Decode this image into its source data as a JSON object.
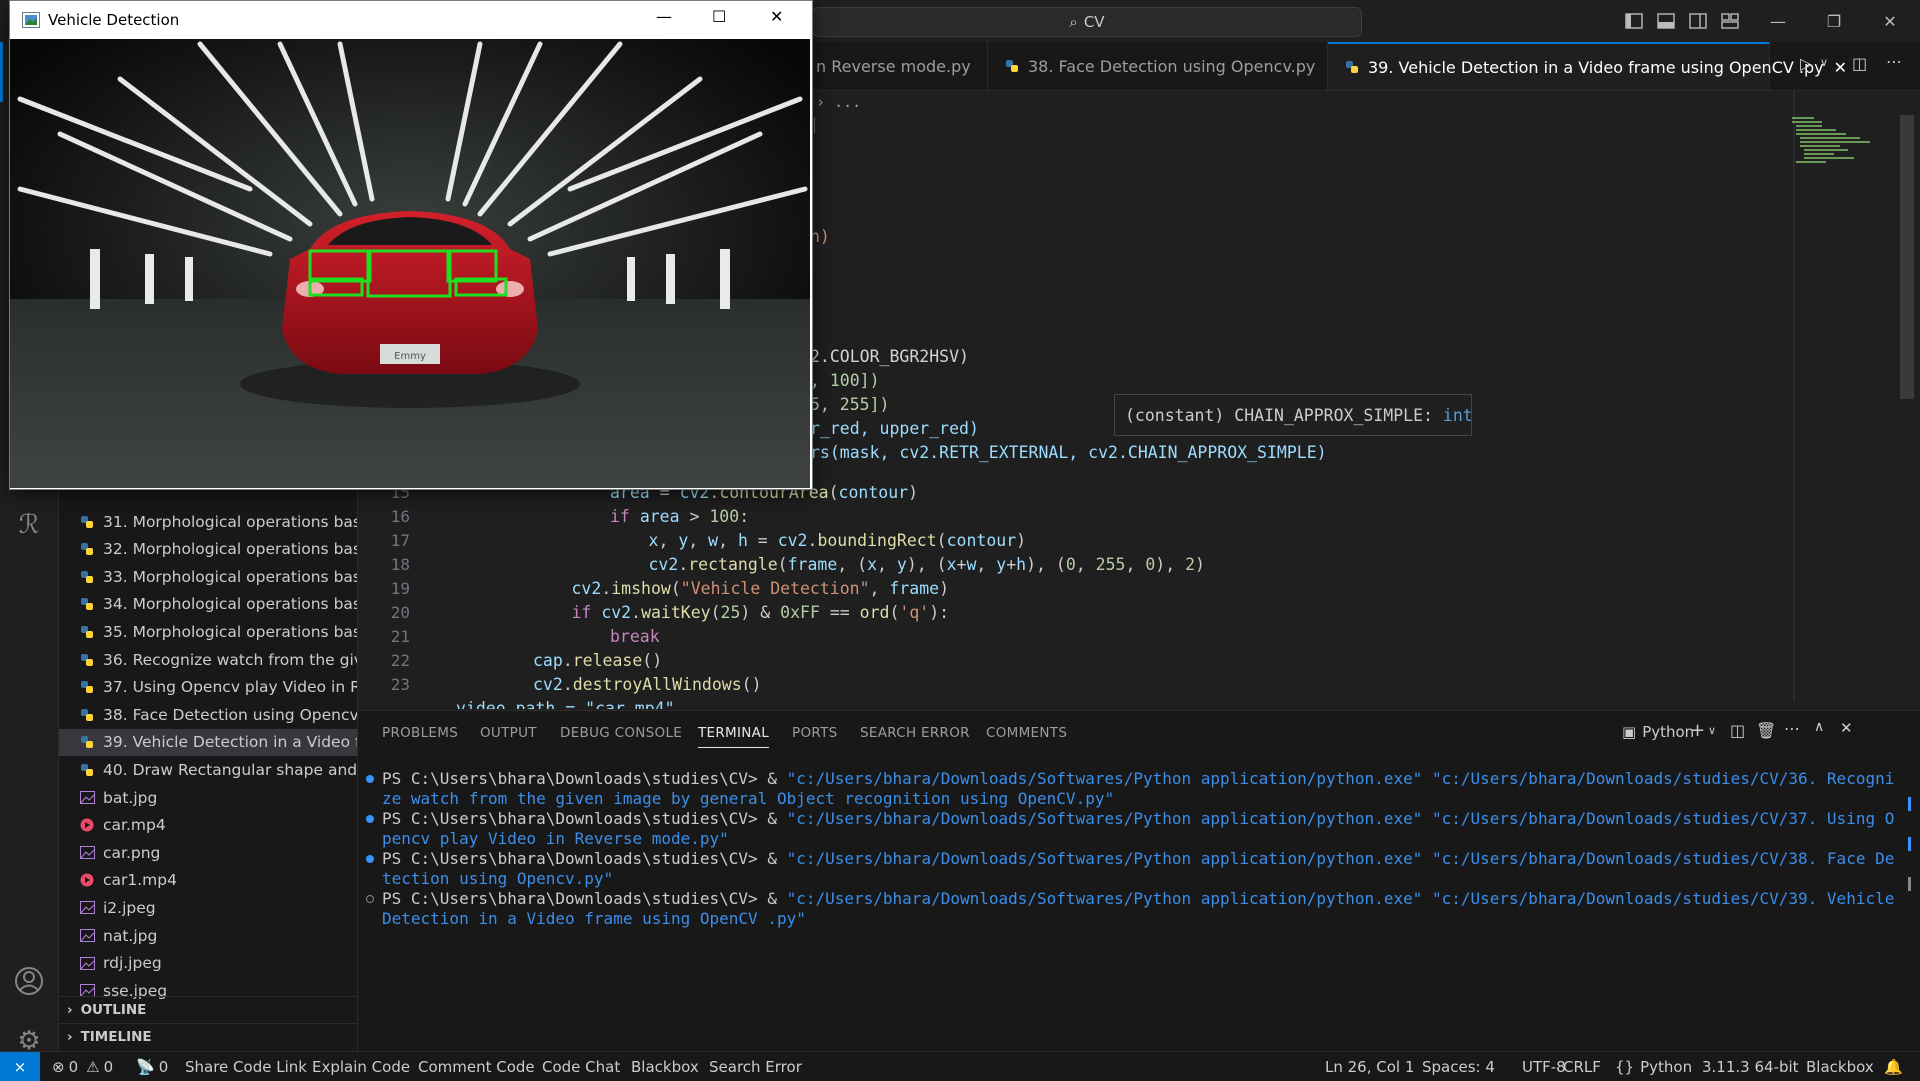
{
  "titlebar": {
    "search_text": "CV"
  },
  "editor_tabs": [
    {
      "label": "n Reverse mode.py"
    },
    {
      "label": "38. Face Detection using Opencv.py"
    },
    {
      "label": "39. Vehicle Detection in a Video frame using OpenCV .py"
    }
  ],
  "breadcrumb": "...",
  "sidebar": {
    "files": [
      {
        "label": "31. Morphological operations bas...",
        "kind": "py"
      },
      {
        "label": "32. Morphological operations bas...",
        "kind": "py"
      },
      {
        "label": "33. Morphological operations bas...",
        "kind": "py"
      },
      {
        "label": "34. Morphological operations bas...",
        "kind": "py"
      },
      {
        "label": "35. Morphological operations bas...",
        "kind": "py"
      },
      {
        "label": "36. Recognize watch from the giv...",
        "kind": "py"
      },
      {
        "label": "37. Using Opencv play Video in R...",
        "kind": "py"
      },
      {
        "label": "38. Face Detection using Opencv....",
        "kind": "py"
      },
      {
        "label": "39. Vehicle Detection in a Video fr...",
        "kind": "py",
        "active": true
      },
      {
        "label": "40. Draw Rectangular shape and ...",
        "kind": "py"
      },
      {
        "label": "bat.jpg",
        "kind": "img"
      },
      {
        "label": "car.mp4",
        "kind": "vid"
      },
      {
        "label": "car.png",
        "kind": "img"
      },
      {
        "label": "car1.mp4",
        "kind": "vid"
      },
      {
        "label": "i2.jpeg",
        "kind": "img"
      },
      {
        "label": "nat.jpg",
        "kind": "img"
      },
      {
        "label": "rdj.jpeg",
        "kind": "img"
      },
      {
        "label": "sse.jpeg",
        "kind": "img"
      }
    ],
    "outline": "OUTLINE",
    "timeline": "TIMELINE"
  },
  "code": {
    "partial_lines": [
      {
        "text": "n)"
      },
      {
        "text": "2.COLOR_BGR2HSV)"
      },
      {
        "text": ", 100])"
      },
      {
        "text": "5, 255])"
      },
      {
        "text": "r_red, upper_red)"
      },
      {
        "text": "rs(mask, cv2.RETR_EXTERNAL, cv2.CHAIN_APPROX_SIMPLE)"
      }
    ],
    "line_numbers": [
      "15",
      "16",
      "17",
      "18",
      "19",
      "20",
      "21",
      "22",
      "23"
    ],
    "lines": [
      "area = cv2.contourArea(contour)",
      "if area > 100:",
      "x, y, w, h = cv2.boundingRect(contour)",
      "cv2.rectangle(frame, (x, y), (x+w, y+h), (0, 255, 0), 2)",
      "cv2.imshow(\"Vehicle Detection\", frame)",
      "if cv2.waitKey(25) & 0xFF == ord('q'):",
      "break",
      "cap.release()",
      "cv2.destroyAllWindows()"
    ],
    "cut_line": "video_path = \"car.mp4\""
  },
  "hover": {
    "prefix": "(constant) CHAIN_APPROX_SIMPLE: ",
    "type": "int"
  },
  "panel": {
    "tabs": [
      "PROBLEMS",
      "OUTPUT",
      "DEBUG CONSOLE",
      "TERMINAL",
      "PORTS",
      "SEARCH ERROR",
      "COMMENTS"
    ],
    "active_tab": "TERMINAL",
    "shell": "Python",
    "terminal": [
      {
        "prompt": "PS C:\\Users\\bhara\\Downloads\\studies\\CV> & ",
        "exe": "\"c:/Users/bhara/Downloads/Softwares/Python application/python.exe\"",
        "script": " \"c:/Users/bhara/Downloads/studies/CV/36. Recognize watch from the given image by general Object recognition using OpenCV.py\"",
        "dot": "#3794ff"
      },
      {
        "prompt": "PS C:\\Users\\bhara\\Downloads\\studies\\CV> & ",
        "exe": "\"c:/Users/bhara/Downloads/Softwares/Python application/python.exe\"",
        "script": " \"c:/Users/bhara/Downloads/studies/CV/37. Using Opencv play Video in Reverse mode.py\"",
        "dot": "#3794ff"
      },
      {
        "prompt": "PS C:\\Users\\bhara\\Downloads\\studies\\CV> & ",
        "exe": "\"c:/Users/bhara/Downloads/Softwares/Python application/python.exe\"",
        "script": " \"c:/Users/bhara/Downloads/studies/CV/38. Face Detection using Opencv.py\"",
        "dot": "#3794ff"
      },
      {
        "prompt": "PS C:\\Users\\bhara\\Downloads\\studies\\CV> & ",
        "exe": "\"c:/Users/bhara/Downloads/Softwares/Python application/python.exe\"",
        "script": " \"c:/Users/bhara/Downloads/studies/CV/39. Vehicle Detection in a Video frame using OpenCV .py\"",
        "dot": "hollow"
      }
    ]
  },
  "statusbar": {
    "errors": "0",
    "warnings": "0",
    "ports": "0",
    "items_left": [
      "Share Code Link",
      "Explain Code",
      "Comment Code",
      "Code Chat",
      "Blackbox",
      "Search Error"
    ],
    "position": "Ln 26, Col 1",
    "spaces": "Spaces: 4",
    "encoding": "UTF-8",
    "eol": "CRLF",
    "language": "Python",
    "interpreter": "3.11.3 64-bit",
    "blackbox": "Blackbox"
  },
  "cv_window": {
    "title": "Vehicle Detection",
    "plate_text": "Emmy"
  },
  "colors": {
    "accent": "#0078d4",
    "remote": "#0078d4",
    "detection_box": "#1fe01f",
    "car_red": "#b5121b"
  }
}
